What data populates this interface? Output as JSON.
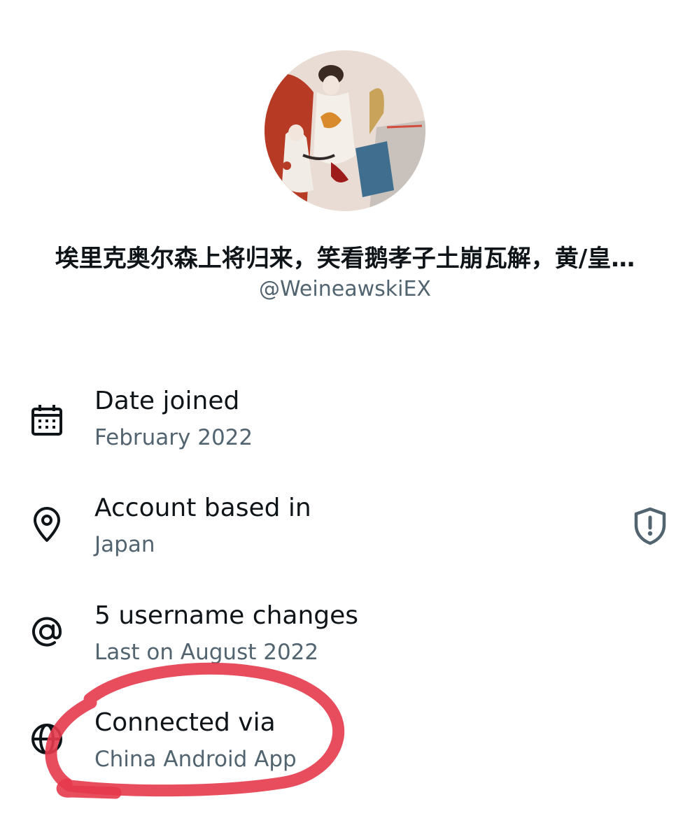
{
  "profile": {
    "display_name": "埃里克奥尔森上将归来，笑看鹅孝子土崩瓦解，黄/皇…",
    "handle": "@WeineawskiEX",
    "avatar_icon": "profile-illustration-avatar"
  },
  "details": [
    {
      "title": "Date joined",
      "subtitle": "February 2022",
      "icon": "calendar-icon"
    },
    {
      "title": "Account based in",
      "subtitle": "Japan",
      "icon": "location-pin-icon",
      "trailing_icon": "shield-alert-icon"
    },
    {
      "title": "5 username changes",
      "subtitle": "Last on August 2022",
      "icon": "at-sign-icon"
    },
    {
      "title": "Connected via",
      "subtitle": "China Android App",
      "icon": "globe-icon"
    }
  ],
  "colors": {
    "primary_text": "#0f1419",
    "secondary_text": "#536471",
    "annotation": "#e63a4c"
  }
}
